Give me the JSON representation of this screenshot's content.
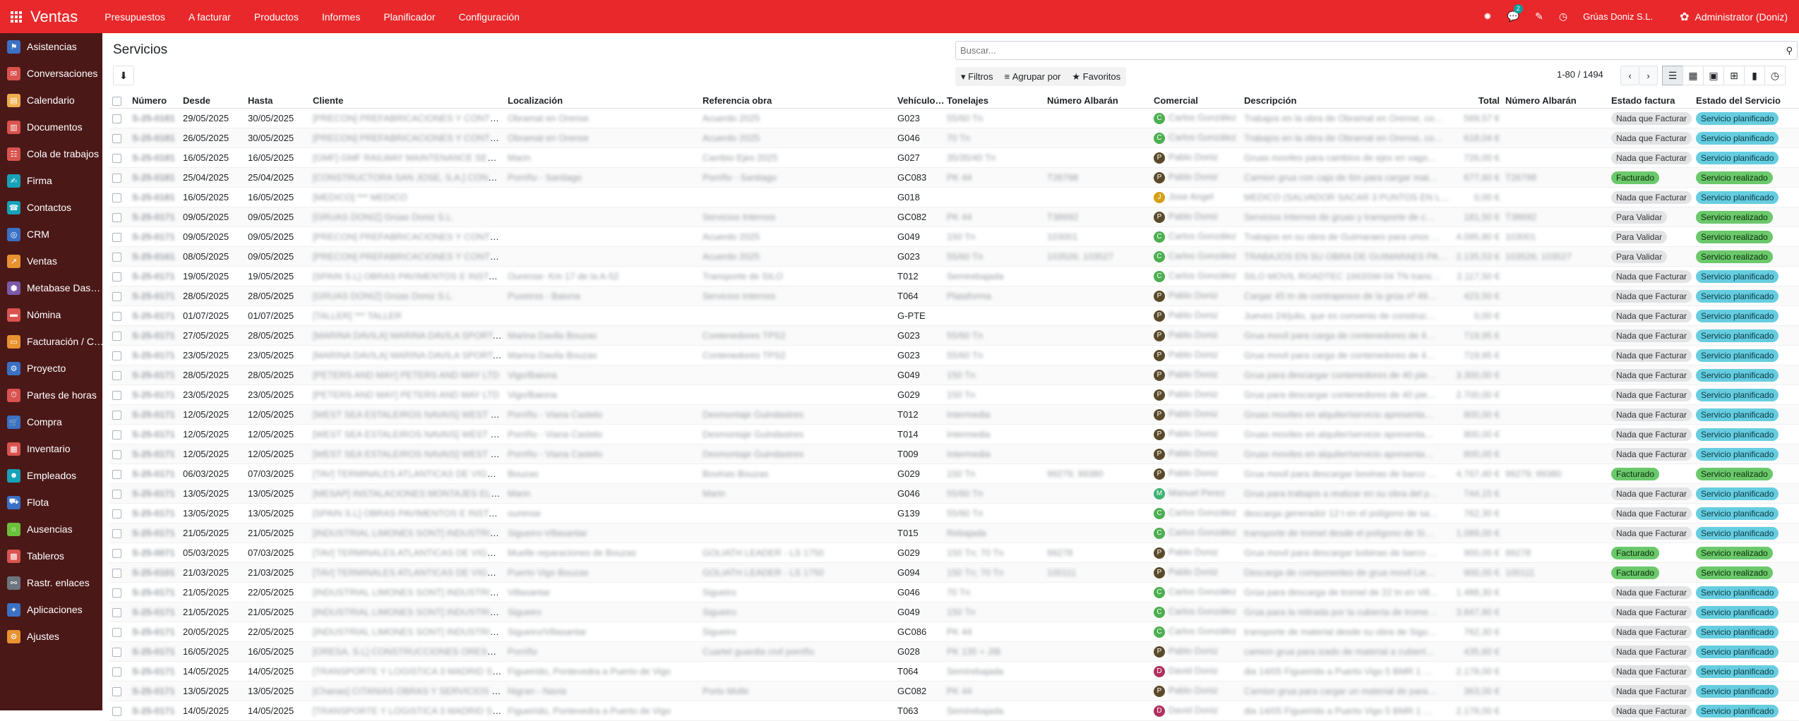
{
  "app": {
    "title": "Ventas"
  },
  "menu": [
    "Presupuestos",
    "A facturar",
    "Productos",
    "Informes",
    "Planificador",
    "Configuración"
  ],
  "topright": {
    "chat_count": "2",
    "company": "Grúas Doniz S.L.",
    "user": "Administrator (Doniz)"
  },
  "sidebar": [
    {
      "label": "Asistencias",
      "color": "#3b71c4"
    },
    {
      "label": "Conversaciones",
      "color": "#d9534f"
    },
    {
      "label": "Calendario",
      "color": "#f0ad4e"
    },
    {
      "label": "Documentos",
      "color": "#d9534f"
    },
    {
      "label": "Cola de trabajos",
      "color": "#d9534f"
    },
    {
      "label": "Firma",
      "color": "#17a2b8"
    },
    {
      "label": "Contactos",
      "color": "#17a2b8"
    },
    {
      "label": "CRM",
      "color": "#3b71c4"
    },
    {
      "label": "Ventas",
      "color": "#e89230"
    },
    {
      "label": "Metabase Das…",
      "color": "#7a5aa8"
    },
    {
      "label": "Nómina",
      "color": "#d9534f"
    },
    {
      "label": "Facturación / C…",
      "color": "#e89230"
    },
    {
      "label": "Proyecto",
      "color": "#3b71c4"
    },
    {
      "label": "Partes de horas",
      "color": "#d9534f"
    },
    {
      "label": "Compra",
      "color": "#3b71c4"
    },
    {
      "label": "Inventario",
      "color": "#d9534f"
    },
    {
      "label": "Empleados",
      "color": "#17a2b8"
    },
    {
      "label": "Flota",
      "color": "#3b71c4"
    },
    {
      "label": "Ausencias",
      "color": "#6bbf3b"
    },
    {
      "label": "Tableros",
      "color": "#d9534f"
    },
    {
      "label": "Rastr. enlaces",
      "color": "#6c757d"
    },
    {
      "label": "Aplicaciones",
      "color": "#3b71c4"
    },
    {
      "label": "Ajustes",
      "color": "#e89230"
    }
  ],
  "page": {
    "title": "Servicios",
    "search_placeholder": "Buscar...",
    "filters": "Filtros",
    "group_by": "Agrupar por",
    "favorites": "Favoritos",
    "pager": "1-80 / 1494"
  },
  "columns": [
    "Número",
    "Desde",
    "Hasta",
    "Cliente",
    "Localización",
    "Referencia obra",
    "Vehículo…",
    "Tonelajes",
    "Número Albarán",
    "Comercial",
    "Descripción",
    "Total",
    "Número Albarán",
    "Estado factura",
    "Estado del Servicio"
  ],
  "rows": [
    {
      "num": "S-25-0181",
      "desde": "29/05/2025",
      "hasta": "30/05/2025",
      "cliente": "[PRECON] PREFABRICACIONES Y CONTRAT…",
      "loc": "Obramat en Orense",
      "ref": "Acuerdo 2025",
      "veh": "G023",
      "ton": "55/60 Tn",
      "alb": "",
      "com": "Carlos González",
      "av": "C",
      "desc": "Trabajos en la obra de Obramat en Orense, co…",
      "total": "569,57 €",
      "alb2": "",
      "fact": "Nada que Facturar",
      "serv": "Servicio planificado"
    },
    {
      "num": "S-25-0181",
      "desde": "26/05/2025",
      "hasta": "30/05/2025",
      "cliente": "[PRECON] PREFABRICACIONES Y CONTRAT…",
      "loc": "Obramat en Orense",
      "ref": "Acuerdo 2025",
      "veh": "G046",
      "ton": "70 Tn",
      "alb": "",
      "com": "Carlos González",
      "av": "C",
      "desc": "Trabajos en la obra de Obramat en Orense, co…",
      "total": "618,04 €",
      "alb2": "",
      "fact": "Nada que Facturar",
      "serv": "Servicio planificado"
    },
    {
      "num": "S-25-0181",
      "desde": "16/05/2025",
      "hasta": "16/05/2025",
      "cliente": "[GMF] GMF RAILWAY MAINTENANCE SERVI…",
      "loc": "Marin",
      "ref": "Cambio Ejes 2025",
      "veh": "G027",
      "ton": "35/35/40 Tn",
      "alb": "",
      "com": "Pablo Doniz",
      "av": "P",
      "desc": "Gruas moviles para cambios de ejes en vago…",
      "total": "726,00 €",
      "alb2": "",
      "fact": "Nada que Facturar",
      "serv": "Servicio planificado"
    },
    {
      "num": "S-25-0181",
      "desde": "25/04/2025",
      "hasta": "25/04/2025",
      "cliente": "[CONSTRUCTORA SAN JOSE, S.A.] CONSTR…",
      "loc": "Porriño - Santiago",
      "ref": "Porriño - Santiago",
      "veh": "GC083",
      "ton": "PK 44",
      "alb": "T26798",
      "com": "Pablo Doniz",
      "av": "P",
      "desc": "Camion grua con caja de 6m para cargar mat…",
      "total": "677,60 €",
      "alb2": "T26798",
      "fact": "Facturado",
      "serv": "Servicio realizado"
    },
    {
      "num": "S-25-0181",
      "desde": "16/05/2025",
      "hasta": "16/05/2025",
      "cliente": "[MEDICO] *** MEDICO",
      "loc": "",
      "ref": "",
      "veh": "G018",
      "ton": "",
      "alb": "",
      "com": "Jose Angel",
      "av": "J",
      "desc": "MEDICO (SALVADOR SACAR 3 PUNTOS EN L…",
      "total": "0,00 €",
      "alb2": "",
      "fact": "Nada que Facturar",
      "serv": "Servicio planificado"
    },
    {
      "num": "S-25-0171",
      "desde": "09/05/2025",
      "hasta": "09/05/2025",
      "cliente": "[GRUAS DONIZ] Grúas Doniz S.L.",
      "loc": "",
      "ref": "Servicios Internos",
      "veh": "GC082",
      "ton": "PK 44",
      "alb": "T38692",
      "com": "Pablo Doniz",
      "av": "P",
      "desc": "Servicios internos de gruas y transporte de c…",
      "total": "181,50 €",
      "alb2": "T38692",
      "fact": "Para Validar",
      "serv": "Servicio realizado"
    },
    {
      "num": "S-25-0171",
      "desde": "09/05/2025",
      "hasta": "09/05/2025",
      "cliente": "[PRECON] PREFABRICACIONES Y CONTRAT…",
      "loc": "",
      "ref": "Acuerdo 2025",
      "veh": "G049",
      "ton": "150 Tn",
      "alb": "103001",
      "com": "Carlos González",
      "av": "C",
      "desc": "Trabajos en su obra de Guimaraes para unos …",
      "total": "4.095,80 €",
      "alb2": "103001",
      "fact": "Para Validar",
      "serv": "Servicio realizado"
    },
    {
      "num": "S-25-0161",
      "desde": "08/05/2025",
      "hasta": "09/05/2025",
      "cliente": "[PRECON] PREFABRICACIONES Y CONTRAT…",
      "loc": "",
      "ref": "Acuerdo 2025",
      "veh": "G023",
      "ton": "55/60 Tn",
      "alb": "103526; 103527",
      "com": "Carlos González",
      "av": "C",
      "desc": "TRABAJOS EN SU OBRA DE GUIMARAES PA…",
      "total": "2.135,53 €",
      "alb2": "103526; 103527",
      "fact": "Para Validar",
      "serv": "Servicio realizado"
    },
    {
      "num": "S-25-0171",
      "desde": "19/05/2025",
      "hasta": "19/05/2025",
      "cliente": "[SPAIN S.L] OBRAS PAVIMENTOS E INSTALA…",
      "loc": "Ourense- Km 17 de la A-52",
      "ref": "Transporte de SILO",
      "veh": "T012",
      "ton": "Semirebajada",
      "alb": "",
      "com": "Carlos González",
      "av": "C",
      "desc": "SILO MOVIL ROADTEC 1663SW-04 TN trans…",
      "total": "2.117,50 €",
      "alb2": "",
      "fact": "Nada que Facturar",
      "serv": "Servicio planificado"
    },
    {
      "num": "S-25-0171",
      "desde": "28/05/2025",
      "hasta": "28/05/2025",
      "cliente": "[GRUAS DONIZ] Grúas Doniz S.L.",
      "loc": "Puxeiros - Baiona",
      "ref": "Servicios Internos",
      "veh": "T064",
      "ton": "Plataforma",
      "alb": "",
      "com": "Pablo Doniz",
      "av": "P",
      "desc": "Cargar 45 tn de contrapesos de la grúa nº 49…",
      "total": "423,50 €",
      "alb2": "",
      "fact": "Nada que Facturar",
      "serv": "Servicio planificado"
    },
    {
      "num": "S-25-0171",
      "desde": "01/07/2025",
      "hasta": "01/07/2025",
      "cliente": "[TALLER] *** TALLER",
      "loc": "",
      "ref": "",
      "veh": "G-PTE",
      "ton": "",
      "alb": "",
      "com": "Pablo Doniz",
      "av": "P",
      "desc": "Jueves 24/julio, que es convenio de construc…",
      "total": "0,00 €",
      "alb2": "",
      "fact": "Nada que Facturar",
      "serv": "Servicio planificado"
    },
    {
      "num": "S-25-0171",
      "desde": "27/05/2025",
      "hasta": "28/05/2025",
      "cliente": "[MARINA DAVILA] MARINA DAVILA SPORT, S…",
      "loc": "Marina Davila Bouzas",
      "ref": "Contenedores TPS2",
      "veh": "G023",
      "ton": "55/60 Tn",
      "alb": "",
      "com": "Pablo Doniz",
      "av": "P",
      "desc": "Grua movil para carga de contenedores de 4…",
      "total": "719,95 €",
      "alb2": "",
      "fact": "Nada que Facturar",
      "serv": "Servicio planificado"
    },
    {
      "num": "S-25-0171",
      "desde": "23/05/2025",
      "hasta": "23/05/2025",
      "cliente": "[MARINA DAVILA] MARINA DAVILA SPORT, S…",
      "loc": "Marina Davila Bouzas",
      "ref": "Contenedores TPS2",
      "veh": "G023",
      "ton": "55/60 Tn",
      "alb": "",
      "com": "Pablo Doniz",
      "av": "P",
      "desc": "Grua movil para carga de contenedores de 4…",
      "total": "719,95 €",
      "alb2": "",
      "fact": "Nada que Facturar",
      "serv": "Servicio planificado"
    },
    {
      "num": "S-25-0171",
      "desde": "28/05/2025",
      "hasta": "28/05/2025",
      "cliente": "[PETERS AND MAY] PETERS AND MAY LTD",
      "loc": "Vigo/Baiona",
      "ref": "",
      "veh": "G049",
      "ton": "150 Tn",
      "alb": "",
      "com": "Pablo Doniz",
      "av": "P",
      "desc": "Grua para descargar contenedores de 40 pie…",
      "total": "3.300,00 €",
      "alb2": "",
      "fact": "Nada que Facturar",
      "serv": "Servicio planificado"
    },
    {
      "num": "S-25-0171",
      "desde": "23/05/2025",
      "hasta": "23/05/2025",
      "cliente": "[PETERS AND MAY] PETERS AND MAY LTD",
      "loc": "Vigo/Baiona",
      "ref": "",
      "veh": "G029",
      "ton": "150 Tn",
      "alb": "",
      "com": "Pablo Doniz",
      "av": "P",
      "desc": "Grua para descargar contenedores de 40 pie…",
      "total": "2.700,00 €",
      "alb2": "",
      "fact": "Nada que Facturar",
      "serv": "Servicio planificado"
    },
    {
      "num": "S-25-0171",
      "desde": "12/05/2025",
      "hasta": "12/05/2025",
      "cliente": "[WEST SEA ESTALEIROS NAVAIS] WEST SEA…",
      "loc": "Porriño - Viana Castelo",
      "ref": "Desmontaje Guindastres",
      "veh": "T012",
      "ton": "Intermedia",
      "alb": "",
      "com": "Pablo Doniz",
      "av": "P",
      "desc": "Gruas moviles en alquiler/servicio apresenta…",
      "total": "800,00 €",
      "alb2": "",
      "fact": "Nada que Facturar",
      "serv": "Servicio planificado"
    },
    {
      "num": "S-25-0171",
      "desde": "12/05/2025",
      "hasta": "12/05/2025",
      "cliente": "[WEST SEA ESTALEIROS NAVAIS] WEST SEA…",
      "loc": "Porriño - Viana Castelo",
      "ref": "Desmontaje Guindastres",
      "veh": "T014",
      "ton": "Intermedia",
      "alb": "",
      "com": "Pablo Doniz",
      "av": "P",
      "desc": "Gruas moviles en alquiler/servicio apresenta…",
      "total": "800,00 €",
      "alb2": "",
      "fact": "Nada que Facturar",
      "serv": "Servicio planificado"
    },
    {
      "num": "S-25-0171",
      "desde": "12/05/2025",
      "hasta": "12/05/2025",
      "cliente": "[WEST SEA ESTALEIROS NAVAIS] WEST SEA…",
      "loc": "Porriño - Viana Castelo",
      "ref": "Desmontaje Guindastres",
      "veh": "T009",
      "ton": "Intermedia",
      "alb": "",
      "com": "Pablo Doniz",
      "av": "P",
      "desc": "Gruas moviles en alquiler/servicio apresenta…",
      "total": "800,00 €",
      "alb2": "",
      "fact": "Nada que Facturar",
      "serv": "Servicio planificado"
    },
    {
      "num": "S-25-0171",
      "desde": "06/03/2025",
      "hasta": "07/03/2025",
      "cliente": "[TAV] TERMINALES ATLANTICAS DE VIGO S.L.",
      "loc": "Bouzas",
      "ref": "Bovinas Bouzas",
      "veh": "G029",
      "ton": "150 Tn",
      "alb": "99279; 99380",
      "com": "Pablo Doniz",
      "av": "P",
      "desc": "Grua movil para descargar bovinas de barco …",
      "total": "4.767,40 €",
      "alb2": "99279; 99380",
      "fact": "Facturado",
      "serv": "Servicio realizado"
    },
    {
      "num": "S-25-0171",
      "desde": "13/05/2025",
      "hasta": "13/05/2025",
      "cliente": "[MESAP] INSTALACIONES MONTAJES ELE…",
      "loc": "Marin",
      "ref": "Marin",
      "veh": "G046",
      "ton": "55/60 Tn",
      "alb": "",
      "com": "Manuel Perez",
      "av": "M",
      "desc": "Grua para trabajos a realizar en su obra del p…",
      "total": "744,15 €",
      "alb2": "",
      "fact": "Nada que Facturar",
      "serv": "Servicio planificado"
    },
    {
      "num": "S-25-0171",
      "desde": "13/05/2025",
      "hasta": "13/05/2025",
      "cliente": "[SPAIN S.L] OBRAS PAVIMENTOS E INSTALA…",
      "loc": "ourense",
      "ref": "",
      "veh": "G139",
      "ton": "55/60 Tn",
      "alb": "",
      "com": "Carlos González",
      "av": "C",
      "desc": "descarga generador 12 t en el polígono de sa…",
      "total": "762,30 €",
      "alb2": "",
      "fact": "Nada que Facturar",
      "serv": "Servicio planificado"
    },
    {
      "num": "S-25-0171",
      "desde": "21/05/2025",
      "hasta": "21/05/2025",
      "cliente": "[INDUSTRIAL LIMONES SONT] INDUSTRIAL …",
      "loc": "Sigueiro-Villasantar",
      "ref": "",
      "veh": "T015",
      "ton": "Rebajada",
      "alb": "",
      "com": "Carlos González",
      "av": "C",
      "desc": "transporte de tromel desde el polígono de Si…",
      "total": "1.089,00 €",
      "alb2": "",
      "fact": "Nada que Facturar",
      "serv": "Servicio planificado"
    },
    {
      "num": "S-25-0071",
      "desde": "05/03/2025",
      "hasta": "07/03/2025",
      "cliente": "[TAV] TERMINALES ATLANTICAS DE VIGO S.L.",
      "loc": "Muelle reparaciones de Bouzas",
      "ref": "GOLIATH LEADER - LS 1750",
      "veh": "G029",
      "ton": "150 Tn; 70 Tn",
      "alb": "99278",
      "com": "Pablo Doniz",
      "av": "P",
      "desc": "Grua movil para descargar bobinas de barco …",
      "total": "900,00 €",
      "alb2": "99278",
      "fact": "Facturado",
      "serv": "Servicio realizado"
    },
    {
      "num": "S-25-0101",
      "desde": "21/03/2025",
      "hasta": "21/03/2025",
      "cliente": "[TAV] TERMINALES ATLANTICAS DE VIGO S.L.",
      "loc": "Puerto Vigo Bouzas",
      "ref": "GOLIATH LEADER - LS 1750",
      "veh": "G094",
      "ton": "150 Tn; 70 Tn",
      "alb": "100111",
      "com": "Pablo Doniz",
      "av": "P",
      "desc": "Descarga de componentes de grua movil Lie…",
      "total": "900,00 €",
      "alb2": "100111",
      "fact": "Facturado",
      "serv": "Servicio realizado"
    },
    {
      "num": "S-25-0171",
      "desde": "21/05/2025",
      "hasta": "22/05/2025",
      "cliente": "[INDUSTRIAL LIMONES SONT] INDUSTRIAL …",
      "loc": "Villasantar",
      "ref": "Sigueiro",
      "veh": "G046",
      "ton": "70 Tn",
      "alb": "",
      "com": "Carlos González",
      "av": "C",
      "desc": "Grúa para descarga de tromel de 22 tn en Vill…",
      "total": "1.488,30 €",
      "alb2": "",
      "fact": "Nada que Facturar",
      "serv": "Servicio planificado"
    },
    {
      "num": "S-25-0171",
      "desde": "21/05/2025",
      "hasta": "21/05/2025",
      "cliente": "[INDUSTRIAL LIMONES SONT] INDUSTRIAL …",
      "loc": "Sigueiro",
      "ref": "Sigueiro",
      "veh": "G049",
      "ton": "150 Tn",
      "alb": "",
      "com": "Carlos González",
      "av": "C",
      "desc": "Grúa para la retirada por la cubierta de trome…",
      "total": "3.847,80 €",
      "alb2": "",
      "fact": "Nada que Facturar",
      "serv": "Servicio planificado"
    },
    {
      "num": "S-25-0171",
      "desde": "20/05/2025",
      "hasta": "22/05/2025",
      "cliente": "[INDUSTRIAL LIMONES SONT] INDUSTRIAL …",
      "loc": "Sigueiro/Villasantar",
      "ref": "Sigueiro",
      "veh": "GC086",
      "ton": "PK 44",
      "alb": "",
      "com": "Carlos González",
      "av": "C",
      "desc": "transporte de material desde su obra de Sigu…",
      "total": "762,30 €",
      "alb2": "",
      "fact": "Nada que Facturar",
      "serv": "Servicio planificado"
    },
    {
      "num": "S-25-0171",
      "desde": "16/05/2025",
      "hasta": "16/05/2025",
      "cliente": "[ORESA, S.L] CONSTRUCCIONES ORESA, S.L…",
      "loc": "Porriño",
      "ref": "Cuartel guardia civil porriño",
      "veh": "G028",
      "ton": "PK 135 + JIB",
      "alb": "",
      "com": "Pablo Doniz",
      "av": "P",
      "desc": "camion grua para izado de material a cubiert…",
      "total": "435,60 €",
      "alb2": "",
      "fact": "Nada que Facturar",
      "serv": "Servicio planificado"
    },
    {
      "num": "S-25-0171",
      "desde": "14/05/2025",
      "hasta": "14/05/2025",
      "cliente": "[TRANSPORTE Y LOGISTICA 3 MADRID SL] …",
      "loc": "Figueirido, Pontevedra a Puerto de Vigo",
      "ref": "",
      "veh": "T064",
      "ton": "Semirebajada",
      "alb": "",
      "com": "David Doniz",
      "av": "D",
      "desc": "dia 14/05 Figueirido a Puerto Vigo 5 BMR 1 …",
      "total": "2.178,00 €",
      "alb2": "",
      "fact": "Nada que Facturar",
      "serv": "Servicio planificado"
    },
    {
      "num": "S-25-0171",
      "desde": "13/05/2025",
      "hasta": "13/05/2025",
      "cliente": "[Chanas] CITANIAS OBRAS Y SERVICIOS S.L…",
      "loc": "Nigran - Navia",
      "ref": "Porto Molle",
      "veh": "GC082",
      "ton": "PK 44",
      "alb": "",
      "com": "Pablo Doniz",
      "av": "P",
      "desc": "Camion grua para cargar un material de para…",
      "total": "363,00 €",
      "alb2": "",
      "fact": "Nada que Facturar",
      "serv": "Servicio planificado"
    },
    {
      "num": "S-25-0171",
      "desde": "14/05/2025",
      "hasta": "14/05/2025",
      "cliente": "[TRANSPORTE Y LOGISTICA 3 MADRID SL] …",
      "loc": "Figueirido, Pontevedra a Puerto de Vigo",
      "ref": "",
      "veh": "T063",
      "ton": "Semirebajada",
      "alb": "",
      "com": "David Doniz",
      "av": "D",
      "desc": "dia 14/05 Figueirido a Puerto Vigo 5 BMR 1 …",
      "total": "2.178,00 €",
      "alb2": "",
      "fact": "Nada que Facturar",
      "serv": "Servicio planificado"
    }
  ],
  "avatar_colors": {
    "C": "#4caf50",
    "P": "#5b4a2a",
    "J": "#d4a017",
    "M": "#3cb371",
    "D": "#b03060"
  }
}
